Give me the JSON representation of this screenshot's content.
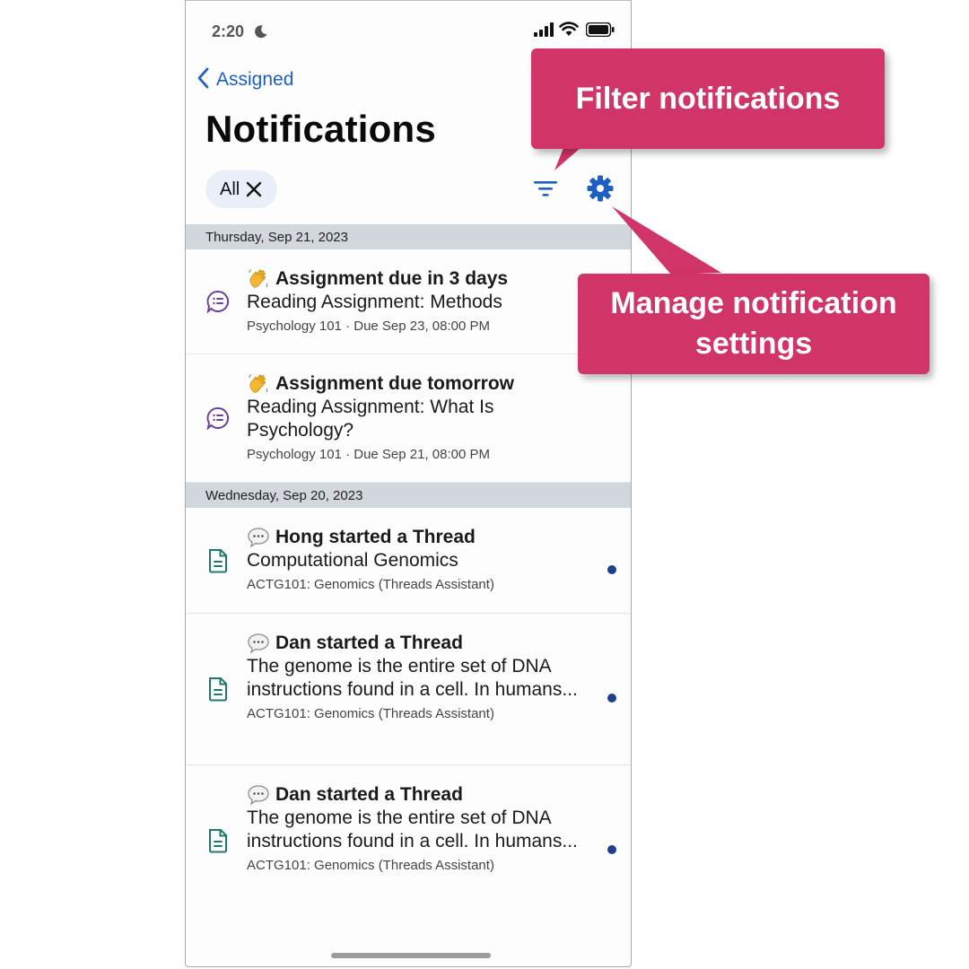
{
  "status_bar": {
    "time": "2:20"
  },
  "nav": {
    "back_label": "Assigned"
  },
  "page": {
    "title": "Notifications"
  },
  "filter_chip": {
    "label": "All"
  },
  "sections": [
    {
      "date": "Thursday, Sep 21, 2023",
      "items": [
        {
          "headline": "Assignment due in 3 days",
          "body": "Reading Assignment: Methods",
          "meta": "Psychology 101 · Due Sep 23, 08:00 PM",
          "icon": "assignment-icon",
          "emoji": "wave-emoji",
          "unread": false
        },
        {
          "headline": "Assignment due tomorrow",
          "body": "Reading Assignment: What Is Psychology?",
          "meta": "Psychology 101 · Due Sep 21, 08:00 PM",
          "icon": "assignment-icon",
          "emoji": "wave-emoji",
          "unread": false
        }
      ]
    },
    {
      "date": "Wednesday, Sep 20, 2023",
      "items": [
        {
          "headline": "Hong started a Thread",
          "body": "Computational Genomics",
          "meta": "ACTG101: Genomics (Threads Assistant)",
          "icon": "document-icon",
          "emoji": "speech-bubble-emoji",
          "unread": true
        },
        {
          "headline": "Dan started a Thread",
          "body": "The genome is the entire set of DNA instructions found in a cell. In humans...",
          "meta": "ACTG101: Genomics (Threads Assistant)",
          "icon": "document-icon",
          "emoji": "speech-bubble-emoji",
          "unread": true
        },
        {
          "headline": "Dan started a Thread",
          "body": "The genome is the entire set of DNA instructions found in a cell. In humans...",
          "meta": "ACTG101: Genomics (Threads Assistant)",
          "icon": "document-icon",
          "emoji": "speech-bubble-emoji",
          "unread": true
        }
      ]
    }
  ],
  "callouts": {
    "filter": "Filter notifications",
    "settings": "Manage notification settings"
  },
  "colors": {
    "accent": "#1e5fc4",
    "callout": "#d13567",
    "unread_dot": "#1d3f8f",
    "date_header_bg": "#d2d6dd",
    "assignment_icon": "#6b3fa0",
    "document_icon": "#1f7a6e"
  }
}
